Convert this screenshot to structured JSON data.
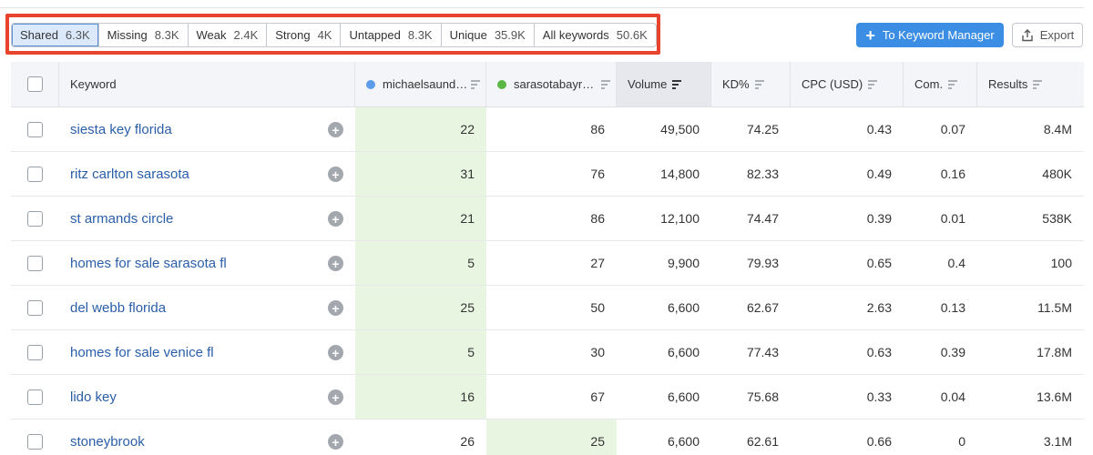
{
  "filters": [
    {
      "label": "Shared",
      "count": "6.3K",
      "active": true
    },
    {
      "label": "Missing",
      "count": "8.3K"
    },
    {
      "label": "Weak",
      "count": "2.4K"
    },
    {
      "label": "Strong",
      "count": "4K"
    },
    {
      "label": "Untapped",
      "count": "8.3K"
    },
    {
      "label": "Unique",
      "count": "35.9K"
    },
    {
      "label": "All keywords",
      "count": "50.6K"
    }
  ],
  "toolbar": {
    "keyword_manager_label": "To Keyword Manager",
    "export_label": "Export"
  },
  "colors": {
    "highlight": "#e8432d",
    "primary": "#3b8ee3",
    "link": "#2a5ea8",
    "domain1_dot": "#5d9ceb",
    "domain2_dot": "#5cb646",
    "best_position_bg": "#e8f5e1"
  },
  "table": {
    "headers": {
      "keyword": "Keyword",
      "domain1": "michaelsaund…",
      "domain2": "sarasotabayr…",
      "volume": "Volume",
      "kd": "KD%",
      "cpc": "CPC (USD)",
      "com": "Com.",
      "results": "Results"
    },
    "rows": [
      {
        "keyword": "siesta key florida",
        "d1": "22",
        "d2": "86",
        "volume": "49,500",
        "kd": "74.25",
        "cpc": "0.43",
        "com": "0.07",
        "results": "8.4M",
        "best": "d1"
      },
      {
        "keyword": "ritz carlton sarasota",
        "d1": "31",
        "d2": "76",
        "volume": "14,800",
        "kd": "82.33",
        "cpc": "0.49",
        "com": "0.16",
        "results": "480K",
        "best": "d1"
      },
      {
        "keyword": "st armands circle",
        "d1": "21",
        "d2": "86",
        "volume": "12,100",
        "kd": "74.47",
        "cpc": "0.39",
        "com": "0.01",
        "results": "538K",
        "best": "d1"
      },
      {
        "keyword": "homes for sale sarasota fl",
        "d1": "5",
        "d2": "27",
        "volume": "9,900",
        "kd": "79.93",
        "cpc": "0.65",
        "com": "0.4",
        "results": "100",
        "best": "d1"
      },
      {
        "keyword": "del webb florida",
        "d1": "25",
        "d2": "50",
        "volume": "6,600",
        "kd": "62.67",
        "cpc": "2.63",
        "com": "0.13",
        "results": "11.5M",
        "best": "d1"
      },
      {
        "keyword": "homes for sale venice fl",
        "d1": "5",
        "d2": "30",
        "volume": "6,600",
        "kd": "77.43",
        "cpc": "0.63",
        "com": "0.39",
        "results": "17.8M",
        "best": "d1"
      },
      {
        "keyword": "lido key",
        "d1": "16",
        "d2": "67",
        "volume": "6,600",
        "kd": "75.68",
        "cpc": "0.33",
        "com": "0.04",
        "results": "13.6M",
        "best": "d1"
      },
      {
        "keyword": "stoneybrook",
        "d1": "26",
        "d2": "25",
        "volume": "6,600",
        "kd": "62.61",
        "cpc": "0.66",
        "com": "0",
        "results": "3.1M",
        "best": "d2"
      }
    ]
  }
}
